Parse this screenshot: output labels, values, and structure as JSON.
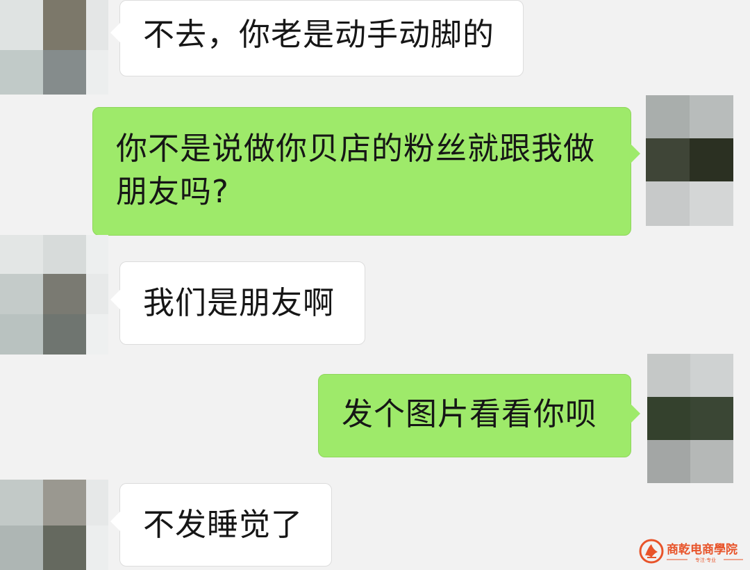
{
  "colors": {
    "background": "#f2f2f2",
    "incoming_bubble": "#ffffff",
    "outgoing_bubble": "#9eea6a",
    "text": "#161616",
    "watermark": "#e8542a"
  },
  "messages": [
    {
      "direction": "incoming",
      "text": "不去，你老是动手动脚的",
      "avatar_icon": "pixelated-avatar-icon",
      "avatar_pixels": [
        "#c9cdcd",
        "#7c786a",
        "#c1cac8",
        "#858c8c"
      ]
    },
    {
      "direction": "outgoing",
      "text": "你不是说做你贝店的粉丝就跟我做\n朋友吗?",
      "avatar_icon": "pixelated-avatar-icon",
      "avatar_pixels": [
        "#a9aeac",
        "#b8bcbb",
        "#3f4537",
        "#2b3022",
        "#c7c9c9",
        "#d4d6d6"
      ]
    },
    {
      "direction": "incoming",
      "text": "我们是朋友啊",
      "avatar_icon": "pixelated-avatar-icon",
      "avatar_pixels": [
        "#c4cbc9",
        "#7a7a72",
        "#b9c2c0",
        "#6f7570"
      ]
    },
    {
      "direction": "outgoing",
      "text": "发个图片看看你呗",
      "avatar_icon": "pixelated-avatar-icon",
      "avatar_pixels": [
        "#c5c8c7",
        "#cfd2d2",
        "#34412d",
        "#3a4634",
        "#a3a6a5",
        "#b5b8b7"
      ]
    },
    {
      "direction": "incoming",
      "text": "不发睡觉了",
      "avatar_icon": "pixelated-avatar-icon",
      "avatar_pixels": [
        "#c2c9c7",
        "#9a9890",
        "#aeb6b4",
        "#65695f"
      ]
    }
  ],
  "watermark": {
    "icon": "shield-logo-icon",
    "name": "商乾电商學院",
    "tagline": "专注·专业"
  }
}
